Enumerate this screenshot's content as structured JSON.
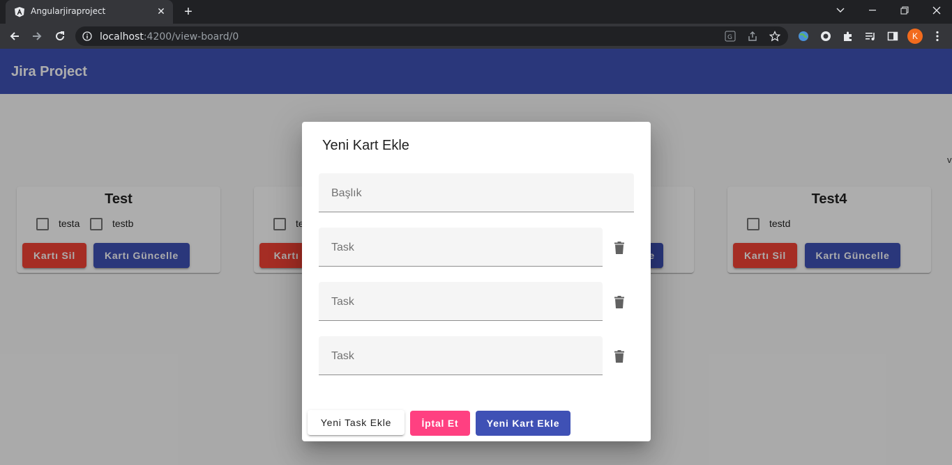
{
  "browser": {
    "tab_title": "Angularjiraproject",
    "url_host": "localhost",
    "url_path": ":4200/view-board/0",
    "profile_initial": "K"
  },
  "app": {
    "title": "Jira Project",
    "stray_text": "v"
  },
  "cards": [
    {
      "title": "Test",
      "tasks": [
        "testa",
        "testb"
      ],
      "delete_label": "Kartı Sil",
      "update_label": "Kartı Güncelle"
    },
    {
      "title": "",
      "tasks": [
        "te"
      ],
      "delete_label": "Kartı S",
      "update_label": ""
    },
    {
      "title": "",
      "tasks": [],
      "delete_label": "",
      "update_label": "e"
    },
    {
      "title": "Test4",
      "tasks": [
        "testd"
      ],
      "delete_label": "Kartı Sil",
      "update_label": "Kartı Güncelle"
    }
  ],
  "dialog": {
    "title": "Yeni Kart Ekle",
    "title_placeholder": "Başlık",
    "task_placeholders": [
      "Task",
      "Task",
      "Task"
    ],
    "add_task_label": "Yeni Task Ekle",
    "cancel_label": "İptal Et",
    "submit_label": "Yeni Kart Ekle"
  },
  "colors": {
    "primary": "#3f51b5",
    "warn": "#f44336",
    "accent": "#ff4081"
  }
}
